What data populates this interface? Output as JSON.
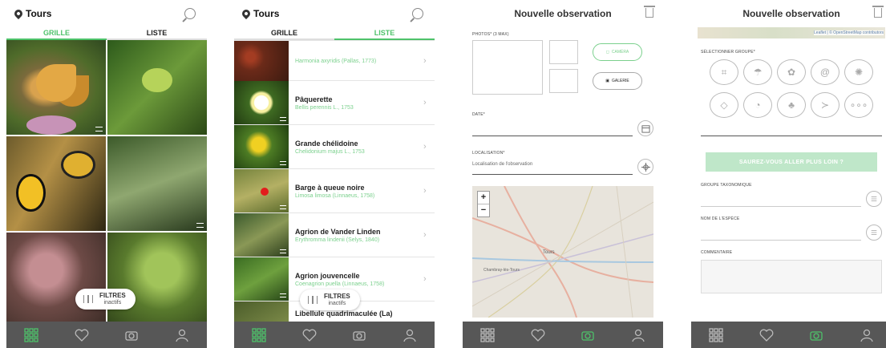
{
  "screen1": {
    "location": "Tours",
    "tabs": [
      "GRILLE",
      "LISTE"
    ],
    "filters": {
      "label": "FILTRES",
      "status": "inactifs"
    }
  },
  "screen2": {
    "location": "Tours",
    "tabs": [
      "GRILLE",
      "LISTE"
    ],
    "species": [
      {
        "name": "",
        "scientific": "Harmonia axyridis (Pallas, 1773)"
      },
      {
        "name": "Pâquerette",
        "scientific": "Bellis perennis L., 1753"
      },
      {
        "name": "Grande chélidoine",
        "scientific": "Chelidonium majus L., 1753"
      },
      {
        "name": "Barge à queue noire",
        "scientific": "Limosa limosa (Linnaeus, 1758)"
      },
      {
        "name": "Agrion de Vander Linden",
        "scientific": "Erythromma lindenii (Selys, 1840)"
      },
      {
        "name": "Agrion jouvencelle",
        "scientific": "Coenagrion puella (Linnaeus, 1758)"
      },
      {
        "name": "Libellule quadrimaculée (La)",
        "scientific": ""
      }
    ],
    "filters": {
      "label": "FILTRES",
      "status": "inactifs"
    }
  },
  "screen3": {
    "title": "Nouvelle observation",
    "photos_label": "PHOTOS* (3 MAX)",
    "camera_label": "CAMÉRA",
    "gallery_label": "GALERIE",
    "date_label": "DATE*",
    "location_label": "LOCALISATION*",
    "location_placeholder": "Localisation de l'observation",
    "zoom_in": "+",
    "zoom_out": "−",
    "map_city": "Tours",
    "map_city2": "Chambray-lès-Tours"
  },
  "screen4": {
    "title": "Nouvelle observation",
    "map_attribution": "Leaflet | © OpenStreetMap contributors",
    "groups_label": "SÉLECTIONNER GROUPE*",
    "more_button": "SAUREZ-VOUS ALLER PLUS LOIN ?",
    "taxon_label": "GROUPE TAXONOMIQUE",
    "species_label": "NOM DE L'ESPÈCE",
    "comment_label": "COMMENTAIRE",
    "group_icons": [
      "grasshopper-icon",
      "mushroom-icon",
      "flower-icon",
      "snail-icon",
      "bug-icon",
      "cat-icon",
      "bird-icon",
      "plant-icon",
      "fish-icon",
      "more-icon"
    ]
  },
  "colors": {
    "accent": "#4ec26a",
    "nav_bg": "#575757",
    "science_name": "#7bd08d"
  },
  "nav_icons": [
    "grid-icon",
    "heart-icon",
    "camera-icon",
    "user-icon"
  ]
}
